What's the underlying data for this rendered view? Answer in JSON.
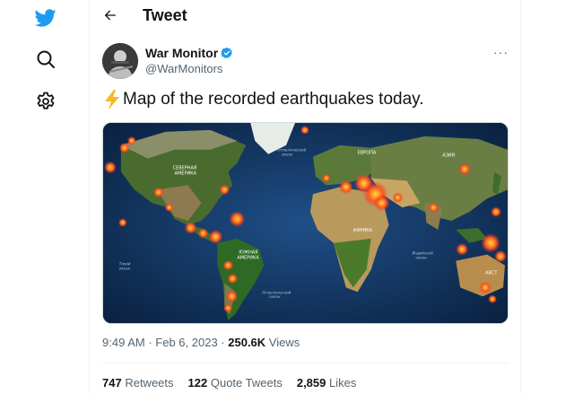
{
  "header": {
    "title": "Tweet"
  },
  "tweet": {
    "author": {
      "name": "War Monitor",
      "handle": "@WarMonitors",
      "verified": true
    },
    "text": "Map of the recorded earthquakes today.",
    "more": "···",
    "map_labels": {
      "north_america": "СЕВЕРНАЯ\nАМЕРИКА",
      "south_america": "ЮЖНАЯ\nАМЕРИКА",
      "europe": "ЕВРОПА",
      "asia": "АЗИЯ",
      "africa": "АФРИКА",
      "australia": "АВСТ",
      "atlantic_north": "Атлантический\nокеан",
      "atlantic_south": "Атлантический\nокеан",
      "pacific": "Тихий\nокеан",
      "indian": "Индийский\nокеан"
    },
    "time": "9:49 AM",
    "date": "Feb 6, 2023",
    "views_count": "250.6K",
    "views_label": "Views",
    "retweets_count": "747",
    "retweets_label": "Retweets",
    "quotes_count": "122",
    "quotes_label": "Quote Tweets",
    "likes_count": "2,859",
    "likes_label": "Likes"
  },
  "colors": {
    "twitter_blue": "#1d9bf0",
    "text": "#0f1419",
    "muted": "#536471",
    "quake_red": "#e8312a"
  },
  "icons": [
    "twitter-logo-icon",
    "search-icon",
    "settings-icon",
    "back-arrow-icon",
    "verified-icon",
    "lightning-bolt-icon",
    "more-icon"
  ]
}
